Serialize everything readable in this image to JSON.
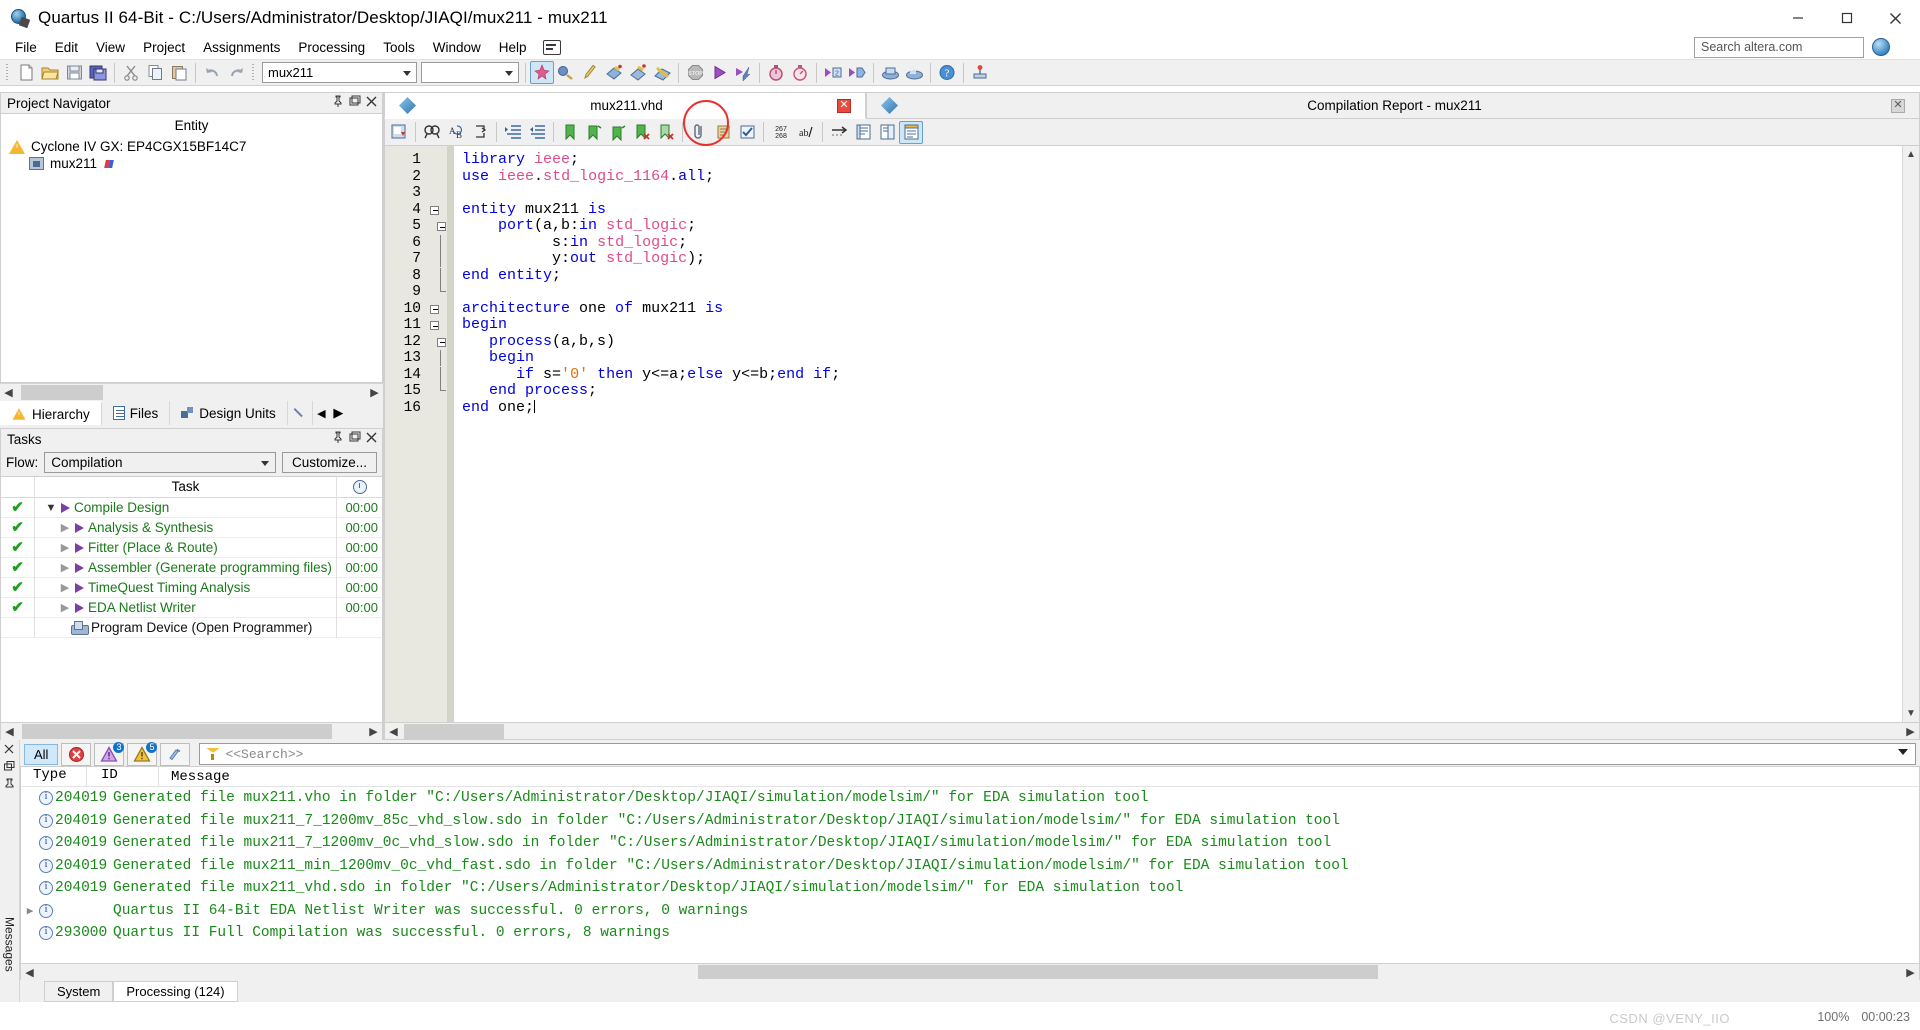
{
  "window": {
    "title": "Quartus II 64-Bit - C:/Users/Administrator/Desktop/JIAQI/mux211 - mux211",
    "app_icon": "quartus-globe-icon",
    "minimize": "minimize-button",
    "maximize": "maximize-button",
    "close": "close-button"
  },
  "menu": {
    "items": [
      {
        "label": "File"
      },
      {
        "label": "Edit"
      },
      {
        "label": "View"
      },
      {
        "label": "Project"
      },
      {
        "label": "Assignments"
      },
      {
        "label": "Processing"
      },
      {
        "label": "Tools"
      },
      {
        "label": "Window"
      },
      {
        "label": "Help"
      }
    ],
    "search_placeholder": "Search altera.com"
  },
  "toolbar": {
    "project_combo_value": "mux211",
    "second_combo_value": "",
    "annotation_color": "#e8312e",
    "buttons": [
      {
        "name": "new-file-icon"
      },
      {
        "name": "open-file-icon"
      },
      {
        "name": "save-file-icon"
      },
      {
        "name": "save-all-icon"
      },
      {
        "name": "cut-icon"
      },
      {
        "name": "copy-icon"
      },
      {
        "name": "paste-icon"
      },
      {
        "name": "undo-icon"
      },
      {
        "name": "redo-icon"
      },
      {
        "name": "compilation-report-icon"
      },
      {
        "name": "settings-icon"
      },
      {
        "name": "pin-planner-icon"
      },
      {
        "name": "assignment-editor-icon"
      },
      {
        "name": "programmer-icon"
      },
      {
        "name": "compiler-tool-icon"
      },
      {
        "name": "stop-compilation-icon"
      },
      {
        "name": "start-compilation-icon"
      },
      {
        "name": "start-analysis-synthesis-icon"
      },
      {
        "name": "timing-analyzer-icon"
      },
      {
        "name": "timequest-icon"
      },
      {
        "name": "start-simulation-icon"
      },
      {
        "name": "rtl-viewer-icon"
      },
      {
        "name": "programmer-device-icon"
      },
      {
        "name": "program-device-icon"
      },
      {
        "name": "help-icon"
      },
      {
        "name": "chip-planner-icon"
      }
    ]
  },
  "project_navigator": {
    "title": "Project Navigator",
    "column_header": "Entity",
    "device": "Cyclone IV GX: EP4CGX15BF14C7",
    "entity": "mux211",
    "tabs": [
      {
        "label": "Hierarchy",
        "icon": "warning-triangle-icon",
        "selected": true
      },
      {
        "label": "Files",
        "icon": "file-icon",
        "selected": false
      },
      {
        "label": "Design Units",
        "icon": "design-units-icon",
        "selected": false
      },
      {
        "label": "",
        "icon": "wand-icon",
        "selected": false
      }
    ]
  },
  "tasks": {
    "title": "Tasks",
    "flow_label": "Flow:",
    "flow_value": "Compilation",
    "customize_label": "Customize...",
    "columns": [
      "",
      "Task",
      "clock-icon"
    ],
    "rows": [
      {
        "done": true,
        "expander": "down",
        "play": true,
        "label": "Compile Design",
        "time": "00:00",
        "level": 0,
        "color": "green"
      },
      {
        "done": true,
        "expander": "right",
        "play": true,
        "label": "Analysis & Synthesis",
        "time": "00:00",
        "level": 1,
        "color": "green"
      },
      {
        "done": true,
        "expander": "right",
        "play": true,
        "label": "Fitter (Place & Route)",
        "time": "00:00",
        "level": 1,
        "color": "green"
      },
      {
        "done": true,
        "expander": "right",
        "play": true,
        "label": "Assembler (Generate programming files)",
        "time": "00:00",
        "level": 1,
        "color": "green"
      },
      {
        "done": true,
        "expander": "right",
        "play": true,
        "label": "TimeQuest Timing Analysis",
        "time": "00:00",
        "level": 1,
        "color": "green"
      },
      {
        "done": true,
        "expander": "right",
        "play": true,
        "label": "EDA Netlist Writer",
        "time": "00:00",
        "level": 1,
        "color": "green"
      },
      {
        "done": false,
        "expander": "none",
        "play": false,
        "label": "Program Device (Open Programmer)",
        "time": "",
        "level": 1,
        "color": "black"
      }
    ]
  },
  "document_tabs": [
    {
      "label": "mux211.vhd",
      "selected": true,
      "closable": true
    },
    {
      "label": "Compilation Report - mux211",
      "selected": false,
      "closable": true
    }
  ],
  "editor_toolbar": {
    "buttons": [
      {
        "name": "bookmark-icon"
      },
      {
        "name": "find-icon"
      },
      {
        "name": "replace-icon"
      },
      {
        "name": "goto-line-icon"
      },
      {
        "name": "increase-indent-icon"
      },
      {
        "name": "decrease-indent-icon"
      },
      {
        "name": "insert-bookmark-icon"
      },
      {
        "name": "next-bookmark-icon"
      },
      {
        "name": "previous-bookmark-icon"
      },
      {
        "name": "clear-bookmark-icon"
      },
      {
        "name": "clear-all-bookmarks-icon"
      },
      {
        "name": "attach-icon"
      },
      {
        "name": "template-icon"
      },
      {
        "name": "check-syntax-icon"
      },
      {
        "name": "line-numbers-icon"
      },
      {
        "name": "abbreviation-icon"
      },
      {
        "name": "word-wrap-icon"
      },
      {
        "name": "show-all-icon"
      },
      {
        "name": "split-view-icon"
      },
      {
        "name": "full-screen-icon"
      }
    ],
    "line_count_label": "267\n268"
  },
  "code": {
    "filename": "mux211.vhd",
    "lines": [
      {
        "n": 1,
        "fold": "none",
        "tokens": [
          {
            "t": "library",
            "c": "kw"
          },
          {
            "t": " ",
            "c": "pl"
          },
          {
            "t": "ieee",
            "c": "ty"
          },
          {
            "t": ";",
            "c": "pl"
          }
        ]
      },
      {
        "n": 2,
        "fold": "none",
        "tokens": [
          {
            "t": "use",
            "c": "kw"
          },
          {
            "t": " ",
            "c": "pl"
          },
          {
            "t": "ieee",
            "c": "ty"
          },
          {
            "t": ".",
            "c": "pl"
          },
          {
            "t": "std_logic_1164",
            "c": "ty"
          },
          {
            "t": ".",
            "c": "pl"
          },
          {
            "t": "all",
            "c": "kw"
          },
          {
            "t": ";",
            "c": "pl"
          }
        ]
      },
      {
        "n": 3,
        "fold": "none",
        "tokens": []
      },
      {
        "n": 4,
        "fold": "box",
        "tokens": [
          {
            "t": "entity",
            "c": "kw"
          },
          {
            "t": " mux211 ",
            "c": "pl"
          },
          {
            "t": "is",
            "c": "kw"
          }
        ]
      },
      {
        "n": 5,
        "fold": "box2",
        "tokens": [
          {
            "t": "    ",
            "c": "pl"
          },
          {
            "t": "port",
            "c": "kw"
          },
          {
            "t": "(a,b:",
            "c": "pl"
          },
          {
            "t": "in",
            "c": "kw"
          },
          {
            "t": " ",
            "c": "pl"
          },
          {
            "t": "std_logic",
            "c": "ty"
          },
          {
            "t": ";",
            "c": "pl"
          }
        ]
      },
      {
        "n": 6,
        "fold": "line2",
        "tokens": [
          {
            "t": "          s:",
            "c": "pl"
          },
          {
            "t": "in",
            "c": "kw"
          },
          {
            "t": " ",
            "c": "pl"
          },
          {
            "t": "std_logic",
            "c": "ty"
          },
          {
            "t": ";",
            "c": "pl"
          }
        ]
      },
      {
        "n": 7,
        "fold": "line2",
        "tokens": [
          {
            "t": "          y:",
            "c": "pl"
          },
          {
            "t": "out",
            "c": "kw"
          },
          {
            "t": " ",
            "c": "pl"
          },
          {
            "t": "std_logic",
            "c": "ty"
          },
          {
            "t": ");",
            "c": "pl"
          }
        ]
      },
      {
        "n": 8,
        "fold": "line",
        "tokens": [
          {
            "t": "end entity",
            "c": "kw"
          },
          {
            "t": ";",
            "c": "pl"
          }
        ]
      },
      {
        "n": 9,
        "fold": "end",
        "tokens": []
      },
      {
        "n": 10,
        "fold": "box",
        "tokens": [
          {
            "t": "architecture",
            "c": "kw"
          },
          {
            "t": " one ",
            "c": "pl"
          },
          {
            "t": "of",
            "c": "kw"
          },
          {
            "t": " mux211 ",
            "c": "pl"
          },
          {
            "t": "is",
            "c": "kw"
          }
        ]
      },
      {
        "n": 11,
        "fold": "box",
        "tokens": [
          {
            "t": "begin",
            "c": "kw"
          }
        ]
      },
      {
        "n": 12,
        "fold": "box2",
        "tokens": [
          {
            "t": "   ",
            "c": "pl"
          },
          {
            "t": "process",
            "c": "kw"
          },
          {
            "t": "(a,b,s)",
            "c": "pl"
          }
        ]
      },
      {
        "n": 13,
        "fold": "line2",
        "tokens": [
          {
            "t": "   ",
            "c": "pl"
          },
          {
            "t": "begin",
            "c": "kw"
          }
        ]
      },
      {
        "n": 14,
        "fold": "line2",
        "tokens": [
          {
            "t": "      ",
            "c": "pl"
          },
          {
            "t": "if",
            "c": "kw"
          },
          {
            "t": " s=",
            "c": "pl"
          },
          {
            "t": "'",
            "c": "num"
          },
          {
            "t": "0",
            "c": "num"
          },
          {
            "t": "'",
            "c": "num"
          },
          {
            "t": " ",
            "c": "pl"
          },
          {
            "t": "then",
            "c": "kw"
          },
          {
            "t": " y<=a;",
            "c": "pl"
          },
          {
            "t": "else",
            "c": "kw"
          },
          {
            "t": " y<=b;",
            "c": "pl"
          },
          {
            "t": "end if",
            "c": "kw"
          },
          {
            "t": ";",
            "c": "pl"
          }
        ]
      },
      {
        "n": 15,
        "fold": "end2",
        "tokens": [
          {
            "t": "   ",
            "c": "pl"
          },
          {
            "t": "end process",
            "c": "kw"
          },
          {
            "t": ";",
            "c": "pl"
          }
        ]
      },
      {
        "n": 16,
        "fold": "none",
        "tokens": [
          {
            "t": "end",
            "c": "kw"
          },
          {
            "t": " one;",
            "c": "pl"
          }
        ]
      }
    ]
  },
  "messages": {
    "filter_tabs": [
      {
        "label": "All",
        "selected": true
      },
      {
        "label": "",
        "icon": "error-icon",
        "badge": ""
      },
      {
        "label": "",
        "icon": "critical-warning-icon",
        "badge": "3"
      },
      {
        "label": "",
        "icon": "warning-icon",
        "badge": "5"
      },
      {
        "label": "",
        "icon": "info-flag-icon",
        "badge": ""
      }
    ],
    "search_placeholder": "<<Search>>",
    "columns": [
      "Type",
      "ID",
      "Message"
    ],
    "rows": [
      {
        "expandable": false,
        "icon": "info-icon",
        "id": "204019",
        "text": "Generated file mux211.vho in folder \"C:/Users/Administrator/Desktop/JIAQI/simulation/modelsim/\" for EDA simulation tool"
      },
      {
        "expandable": false,
        "icon": "info-icon",
        "id": "204019",
        "text": "Generated file mux211_7_1200mv_85c_vhd_slow.sdo in folder \"C:/Users/Administrator/Desktop/JIAQI/simulation/modelsim/\" for EDA simulation tool"
      },
      {
        "expandable": false,
        "icon": "info-icon",
        "id": "204019",
        "text": "Generated file mux211_7_1200mv_0c_vhd_slow.sdo in folder \"C:/Users/Administrator/Desktop/JIAQI/simulation/modelsim/\" for EDA simulation tool"
      },
      {
        "expandable": false,
        "icon": "info-icon",
        "id": "204019",
        "text": "Generated file mux211_min_1200mv_0c_vhd_fast.sdo in folder \"C:/Users/Administrator/Desktop/JIAQI/simulation/modelsim/\" for EDA simulation tool"
      },
      {
        "expandable": false,
        "icon": "info-icon",
        "id": "204019",
        "text": "Generated file mux211_vhd.sdo in folder \"C:/Users/Administrator/Desktop/JIAQI/simulation/modelsim/\" for EDA simulation tool"
      },
      {
        "expandable": true,
        "icon": "info-icon",
        "id": "",
        "text": "Quartus II 64-Bit EDA Netlist Writer was successful. 0 errors, 0 warnings"
      },
      {
        "expandable": false,
        "icon": "info-icon",
        "id": "293000",
        "text": "Quartus II Full Compilation was successful. 0 errors, 8 warnings"
      }
    ],
    "bottom_tabs": [
      {
        "label": "System",
        "selected": false
      },
      {
        "label": "Processing (124)",
        "selected": true
      }
    ],
    "vertical_label": "Messages"
  },
  "status_bar": {
    "zoom": "100%",
    "time": "00:00:23",
    "watermark": "CSDN @VENY_IIO"
  }
}
